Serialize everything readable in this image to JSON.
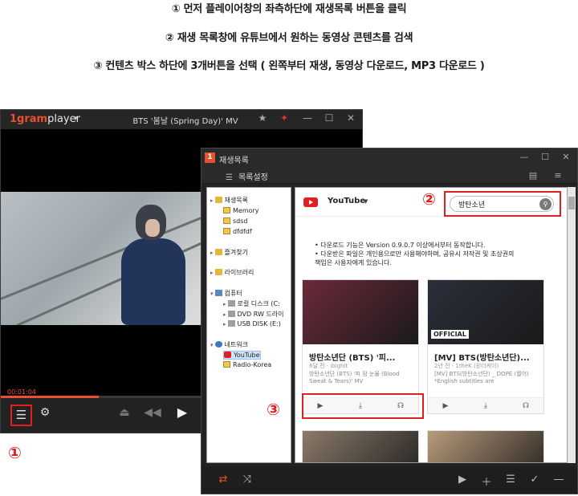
{
  "instructions": [
    "① 먼저 플레이어창의 좌측하단에 재생목록 버튼을 클릭",
    "② 재생 목록창에 유튜브에서 원하는 동영상 콘텐츠를 검색",
    "③ 컨텐츠 박스 하단에  3개버튼을 선택 ( 왼쪽부터 재생, 동영상 다운로드, MP3 다운로드 )"
  ],
  "player": {
    "logo_1": "1gram",
    "logo_2": "player",
    "title": "BTS '봄날 (Spring Day)' MV",
    "time": "00:01:04",
    "progress": 0.27,
    "title_icons": [
      "star-icon",
      "pin-icon",
      "minimize-icon",
      "maximize-icon",
      "close-icon"
    ],
    "control_icons": [
      "playlist-icon",
      "gear-icon",
      "eject-icon",
      "rewind-icon",
      "play-icon"
    ]
  },
  "step_marks": [
    "①",
    "②",
    "③"
  ],
  "playlist": {
    "title": "재생목록",
    "settings_label": "목록설정",
    "tree": [
      {
        "label": "재생목록",
        "kind": "folder",
        "level": 0,
        "toggle": "▸"
      },
      {
        "label": "Memory",
        "kind": "file",
        "level": 1,
        "toggle": ""
      },
      {
        "label": "sdsd",
        "kind": "file",
        "level": 1,
        "toggle": ""
      },
      {
        "label": "dfdfdf",
        "kind": "file",
        "level": 1,
        "toggle": ""
      },
      {
        "label": "즐겨찾기",
        "kind": "star",
        "level": 0,
        "toggle": "▸"
      },
      {
        "label": "라이브러리",
        "kind": "folder",
        "level": 0,
        "toggle": "▸"
      },
      {
        "label": "컴퓨터",
        "kind": "pc",
        "level": 0,
        "toggle": "▾"
      },
      {
        "label": "로컬 디스크 (C:",
        "kind": "drive",
        "level": 1,
        "toggle": "▸"
      },
      {
        "label": "DVD RW 드라이",
        "kind": "drive",
        "level": 1,
        "toggle": "▸"
      },
      {
        "label": "USB DISK (E:)",
        "kind": "drive",
        "level": 1,
        "toggle": "▸"
      },
      {
        "label": "네트워크",
        "kind": "net",
        "level": 0,
        "toggle": "▾"
      },
      {
        "label": "YouTube",
        "kind": "yt",
        "level": 1,
        "toggle": "",
        "selected": true
      },
      {
        "label": "Radio-Korea",
        "kind": "file",
        "level": 1,
        "toggle": ""
      }
    ],
    "source": "YouTube",
    "search_value": "방탄소년",
    "notice": [
      "• 다운로드 기능은 Version 0.9.0.7 이상에서부터 동작합니다.",
      "• 다운받은 파일은 개인용으로만 사용해야하며, 공유시 저작권 및 초상권의",
      "   책임은 사용자에게 있습니다."
    ],
    "cards": [
      {
        "title": "방탄소년단 (BTS) '피...",
        "meta": "6달 전 · ibighit",
        "desc": "방탄소년단 (BTS) '피 땀 눈물 (Blood Sweat & Tears)' MV",
        "thumb_color": "#6b2a3a"
      },
      {
        "title": "[MV] BTS(방탄소년단)...",
        "meta": "2년 전 · 1theK (원더케이)",
        "desc": "[MV] BTS(방탄소년단) _ DOPE (쩔어) *English subtitles are",
        "thumb_color": "#2a2f3a",
        "badge": "OFFICIAL"
      },
      {
        "title": "",
        "meta": "",
        "desc": "",
        "thumb_color": "#8a7a6a"
      },
      {
        "title": "",
        "meta": "",
        "desc": "",
        "thumb_color": "#b89a7a"
      }
    ],
    "card_actions": [
      "play-icon",
      "download-icon",
      "headphone-icon"
    ],
    "bottom_icons": [
      "repeat-icon",
      "shuffle-icon",
      "play-icon",
      "add-icon",
      "list-add-icon",
      "check-icon",
      "remove-icon"
    ]
  }
}
